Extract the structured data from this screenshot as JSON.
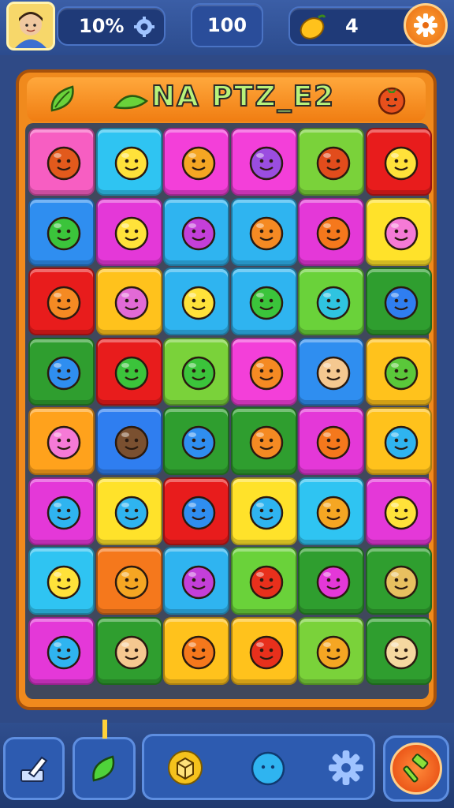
{
  "hud": {
    "percent": "10%",
    "score": "100",
    "coins": "4",
    "icons": {
      "avatar": "player-avatar",
      "percent": "cog-icon",
      "coin": "lemon-icon",
      "settings": "gear-icon"
    }
  },
  "board": {
    "title": "NA PTZ_E2",
    "cols": 6,
    "rows": 8,
    "tiles": [
      {
        "bg": "#f75ec2",
        "face": "#e25a1c"
      },
      {
        "bg": "#2fc4f2",
        "face": "#ffe23a"
      },
      {
        "bg": "#f33fd9",
        "face": "#f5a623"
      },
      {
        "bg": "#f33fd9",
        "face": "#9b4de0"
      },
      {
        "bg": "#7ad23a",
        "face": "#e24c1c"
      },
      {
        "bg": "#e81c1c",
        "face": "#ffe23a"
      },
      {
        "bg": "#2f8ef0",
        "face": "#3bc43b"
      },
      {
        "bg": "#e438d8",
        "face": "#ffe23a"
      },
      {
        "bg": "#2fb4f0",
        "face": "#c43fd9"
      },
      {
        "bg": "#2fb4f0",
        "face": "#f58a23"
      },
      {
        "bg": "#e438d8",
        "face": "#f5781c"
      },
      {
        "bg": "#ffe22a",
        "face": "#f57ad6"
      },
      {
        "bg": "#e81c1c",
        "face": "#f58a23"
      },
      {
        "bg": "#ffc21c",
        "face": "#e26ad6"
      },
      {
        "bg": "#2fb4f0",
        "face": "#ffe23a"
      },
      {
        "bg": "#2fb4f0",
        "face": "#3bc43b"
      },
      {
        "bg": "#6ad23a",
        "face": "#2fc4e0"
      },
      {
        "bg": "#2f9e2f",
        "face": "#2f7ef0"
      },
      {
        "bg": "#2f9e2f",
        "face": "#2f8ef0"
      },
      {
        "bg": "#e81c1c",
        "face": "#3bc43b"
      },
      {
        "bg": "#7ad23a",
        "face": "#3bc43b"
      },
      {
        "bg": "#f33fd9",
        "face": "#f58a23"
      },
      {
        "bg": "#2f8ef0",
        "face": "#f5c890"
      },
      {
        "bg": "#ffc21c",
        "face": "#5ac83a"
      },
      {
        "bg": "#ffa21c",
        "face": "#f57ad6"
      },
      {
        "bg": "#2f7ef0",
        "face": "#7a5030"
      },
      {
        "bg": "#2f9e2f",
        "face": "#2f8ef0"
      },
      {
        "bg": "#2f9e2f",
        "face": "#f58a23"
      },
      {
        "bg": "#e438d8",
        "face": "#f5781c"
      },
      {
        "bg": "#ffc21c",
        "face": "#2fb4f0"
      },
      {
        "bg": "#e438d8",
        "face": "#2fb4f0"
      },
      {
        "bg": "#ffe22a",
        "face": "#2fb4f0"
      },
      {
        "bg": "#e81c1c",
        "face": "#2f8ef0"
      },
      {
        "bg": "#ffe22a",
        "face": "#2fb4f0"
      },
      {
        "bg": "#2fc4f2",
        "face": "#f5a623"
      },
      {
        "bg": "#e438d8",
        "face": "#ffe23a"
      },
      {
        "bg": "#2fc4f2",
        "face": "#ffe23a"
      },
      {
        "bg": "#f5781c",
        "face": "#f5a623"
      },
      {
        "bg": "#2fb4f0",
        "face": "#c43fd9"
      },
      {
        "bg": "#6ad23a",
        "face": "#e8301c"
      },
      {
        "bg": "#2f9e2f",
        "face": "#e438d8"
      },
      {
        "bg": "#2f9e2f",
        "face": "#e8c060"
      },
      {
        "bg": "#e438d8",
        "face": "#2fb4f0"
      },
      {
        "bg": "#2f9e2f",
        "face": "#f5c890"
      },
      {
        "bg": "#ffc21c",
        "face": "#f5781c"
      },
      {
        "bg": "#ffc21c",
        "face": "#e8301c"
      },
      {
        "bg": "#7ad23a",
        "face": "#f5a623"
      },
      {
        "bg": "#2f9e2f",
        "face": "#f5d8a0"
      }
    ]
  },
  "toolbar": {
    "items": [
      "pencil-icon",
      "leaf-icon",
      "cube-icon",
      "blob-icon",
      "gear-icon",
      "hammer-icon"
    ]
  }
}
